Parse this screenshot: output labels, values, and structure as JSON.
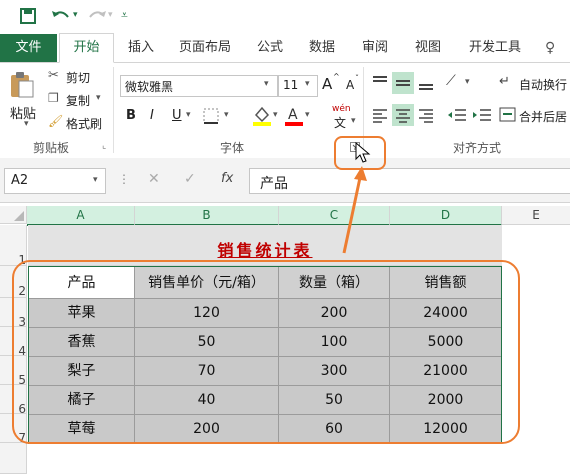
{
  "qat": {
    "save_icon": "save-icon",
    "undo_icon": "undo-icon",
    "redo_icon": "redo-icon",
    "customize_icon": "customize-icon"
  },
  "tabs": [
    "文件",
    "开始",
    "插入",
    "页面布局",
    "公式",
    "数据",
    "审阅",
    "视图",
    "开发工具"
  ],
  "ribbon": {
    "paste": "粘贴",
    "cut": "剪切",
    "copy": "复制",
    "format_painter": "格式刷",
    "clipboard_group": "剪贴板",
    "font_name": "微软雅黑",
    "font_size": "11",
    "grow_font": "A",
    "shrink_font": "A",
    "bold": "B",
    "italic": "I",
    "underline": "U",
    "wen": "wén",
    "wen_char": "文",
    "font_group": "字体",
    "wrap_text": "自动换行",
    "merge_center": "合并后居",
    "alignment_group": "对齐方式"
  },
  "formula_bar": {
    "name_box": "A2",
    "fx": "fx",
    "content": "产品"
  },
  "columns": [
    "A",
    "B",
    "C",
    "D",
    "E"
  ],
  "rows": [
    "1",
    "2",
    "3",
    "4",
    "5",
    "6",
    "7"
  ],
  "sheet": {
    "title": "销售统计表",
    "headers": [
      "产品",
      "销售单价（元/箱）",
      "数量（箱）",
      "销售额"
    ],
    "data": [
      [
        "苹果",
        "120",
        "200",
        "24000"
      ],
      [
        "香蕉",
        "50",
        "100",
        "5000"
      ],
      [
        "梨子",
        "70",
        "300",
        "21000"
      ],
      [
        "橘子",
        "40",
        "50",
        "2000"
      ],
      [
        "草莓",
        "200",
        "60",
        "12000"
      ]
    ]
  },
  "colors": {
    "excel_green": "#217346",
    "annotation_orange": "#ed7d31",
    "title_red": "#c00000"
  }
}
